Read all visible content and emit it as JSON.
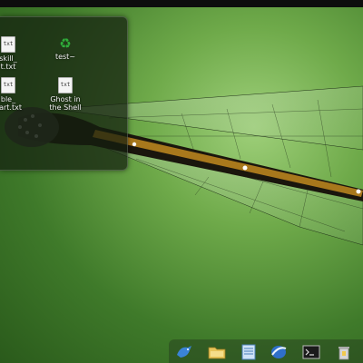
{
  "desktop": {
    "icons": [
      {
        "name": "skill-txt",
        "type": "txt",
        "badge": "txt",
        "line1": "skill_",
        "line2": "t.txt"
      },
      {
        "name": "test",
        "type": "recycle",
        "badge": "",
        "line1": "test~",
        "line2": ""
      },
      {
        "name": "ble-txt",
        "type": "txt",
        "badge": "txt",
        "line1": "ble_",
        "line2": "nart.txt"
      },
      {
        "name": "ghost-in-the-shell",
        "type": "txt",
        "badge": "txt",
        "line1": "Ghost in",
        "line2": "the Shell"
      }
    ]
  },
  "taskbar": {
    "launchers": [
      {
        "name": "bird-launcher"
      },
      {
        "name": "folder-launcher"
      },
      {
        "name": "document-launcher"
      },
      {
        "name": "browser-launcher"
      },
      {
        "name": "terminal-launcher"
      },
      {
        "name": "trash-launcher"
      }
    ]
  },
  "colors": {
    "wallpaper_light": "#9fd07a",
    "wallpaper_dark": "#2a5a1b",
    "topbar": "#0d0d0d",
    "recycle": "#2fae3a"
  }
}
